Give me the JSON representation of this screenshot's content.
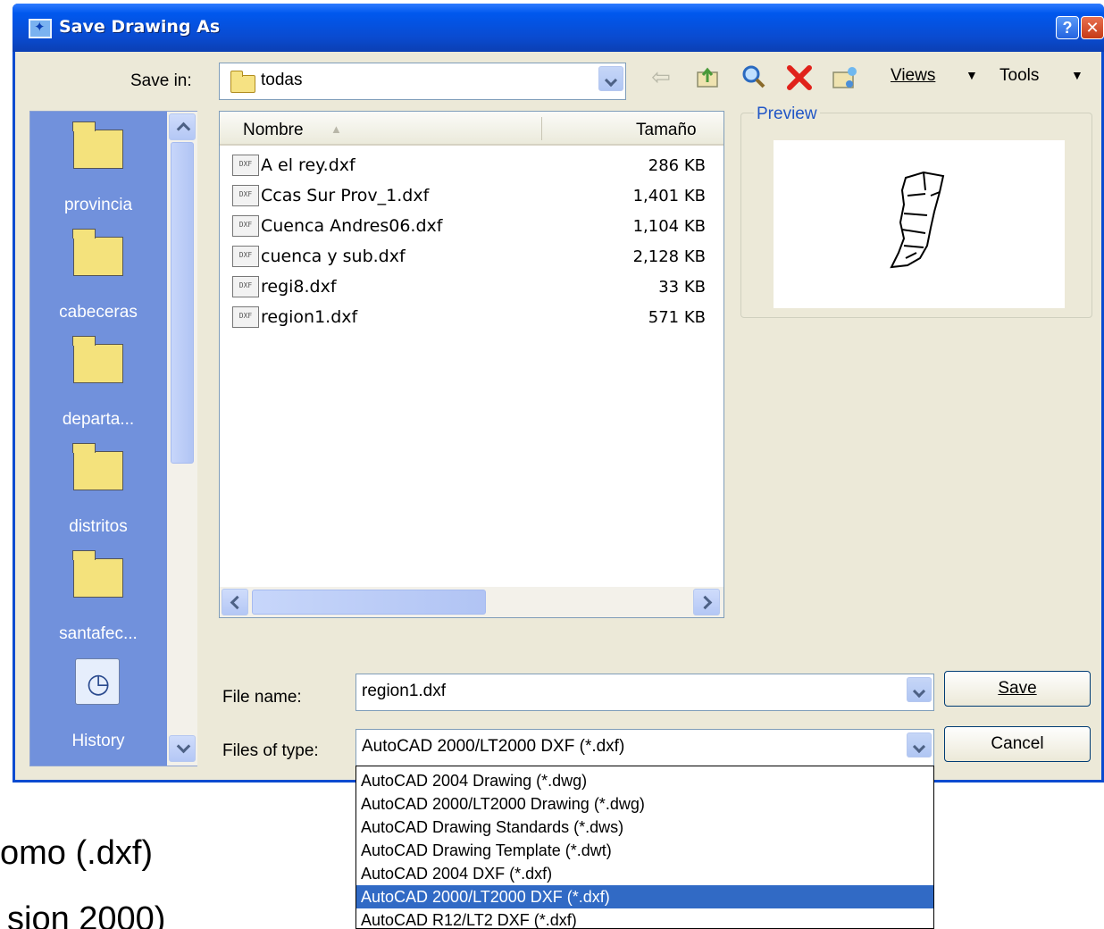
{
  "window": {
    "title": "Save Drawing As",
    "help_label": "?",
    "close_label": "✕"
  },
  "toolbar": {
    "save_in_label": "Save in:",
    "save_in_value": "todas",
    "views_label": "Views",
    "tools_label": "Tools"
  },
  "places": [
    {
      "label": "provincia",
      "icon": "folder-icon"
    },
    {
      "label": "cabeceras",
      "icon": "folder-icon"
    },
    {
      "label": "departa...",
      "icon": "folder-icon"
    },
    {
      "label": "distritos",
      "icon": "folder-icon"
    },
    {
      "label": "santafec...",
      "icon": "folder-icon"
    },
    {
      "label": "History",
      "icon": "history-icon"
    }
  ],
  "filelist": {
    "col_name": "Nombre",
    "col_size": "Tamaño",
    "files": [
      {
        "name": "A el rey.dxf",
        "size": "286 KB"
      },
      {
        "name": "Ccas Sur Prov_1.dxf",
        "size": "1,401 KB"
      },
      {
        "name": "Cuenca Andres06.dxf",
        "size": "1,104 KB"
      },
      {
        "name": "cuenca y sub.dxf",
        "size": "2,128 KB"
      },
      {
        "name": "regi8.dxf",
        "size": "33 KB"
      },
      {
        "name": "region1.dxf",
        "size": "571 KB"
      }
    ]
  },
  "preview": {
    "label": "Preview"
  },
  "form": {
    "file_name_label": "File name:",
    "file_name_value": "region1.dxf",
    "files_of_type_label": "Files of type:",
    "files_of_type_value": "AutoCAD 2000/LT2000 DXF (*.dxf)",
    "save_label": "Save",
    "cancel_label": "Cancel"
  },
  "type_options": [
    {
      "label": "AutoCAD 2004 Drawing (*.dwg)",
      "selected": false
    },
    {
      "label": "AutoCAD 2000/LT2000 Drawing (*.dwg)",
      "selected": false
    },
    {
      "label": "AutoCAD Drawing Standards (*.dws)",
      "selected": false
    },
    {
      "label": "AutoCAD Drawing Template (*.dwt)",
      "selected": false
    },
    {
      "label": "AutoCAD 2004 DXF (*.dxf)",
      "selected": false
    },
    {
      "label": "AutoCAD 2000/LT2000 DXF (*.dxf)",
      "selected": true
    },
    {
      "label": "AutoCAD R12/LT2 DXF (*.dxf)",
      "selected": false
    }
  ],
  "background_text": {
    "line1": "omo (.dxf)",
    "line2": "sion 2000)"
  }
}
